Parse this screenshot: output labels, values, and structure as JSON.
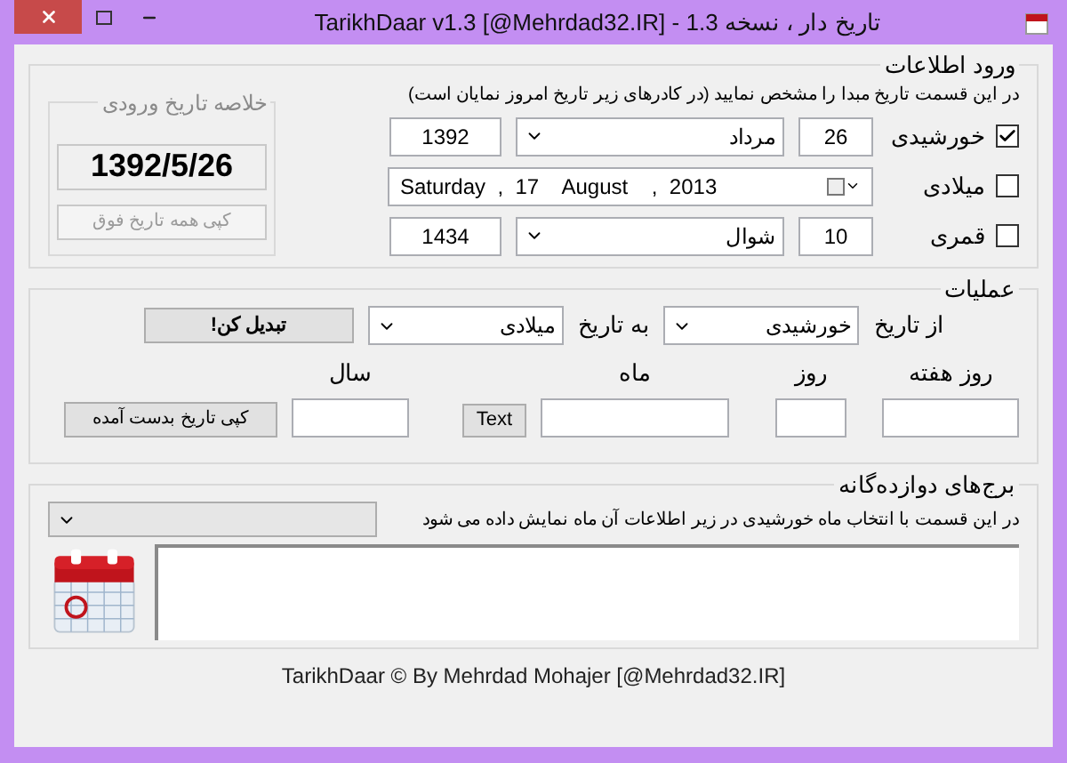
{
  "window": {
    "title": "تاریخ دار ، نسخه 1.3 - TarikhDaar v1.3 [@Mehrdad32.IR]"
  },
  "input_section": {
    "title": "ورود اطلاعات",
    "hint": "در این قسمت تاریخ مبدا را مشخص نمایید (در کادرهای زیر تاریخ امروز نمایان است)",
    "calendars": [
      {
        "kind": "fields",
        "label": "خورشیدی",
        "checked": true,
        "day": "26",
        "month": "مرداد",
        "year": "1392"
      },
      {
        "kind": "picker",
        "label": "میلادی",
        "checked": false,
        "date": "Saturday  ,  17    August    ,  2013"
      },
      {
        "kind": "fields",
        "label": "قمری",
        "checked": false,
        "day": "10",
        "month": "شوال",
        "year": "1434"
      }
    ],
    "summary": {
      "title": "خلاصه تاریخ ورودی",
      "date": "1392/5/26",
      "copy_button": {
        "label": "کپی همه تاریخ فوق",
        "disabled": true
      }
    }
  },
  "operations": {
    "title": "عملیات",
    "from_label": "از تاریخ",
    "from_value": "خورشیدی",
    "to_label": "به تاریخ",
    "to_value": "میلادی",
    "convert_button": "تبدیل کن!",
    "weekday_label": "روز هفته",
    "day_label": "روز",
    "month_label": "ماه",
    "text_button": "Text",
    "year_label": "سال",
    "copy_button": "کپی تاریخ بدست آمده"
  },
  "zodiac": {
    "title": "برج‌های دوازده‌گانه",
    "hint": "در این قسمت با انتخاب ماه خورشیدی در زیر اطلاعات آن ماه نمایش داده می شود"
  },
  "footer": "TarikhDaar © By Mehrdad Mohajer [@Mehrdad32.IR]"
}
